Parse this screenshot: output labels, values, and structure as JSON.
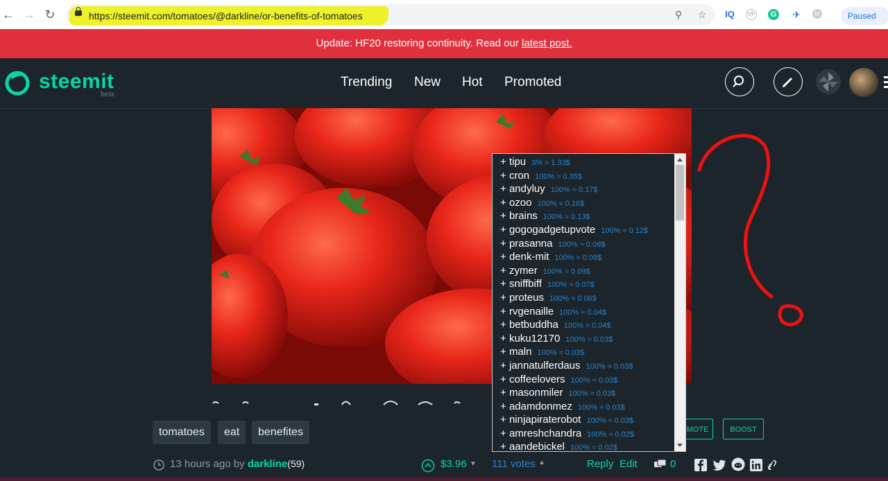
{
  "browser": {
    "url": "https://steemit.com/tomatoes/@darkline/or-benefits-of-tomatoes",
    "paused_label": "Paused",
    "ext_iq": "IQ",
    "ext_vp": "VP",
    "ext_g": "G",
    "ext_m": "M"
  },
  "banner": {
    "text": "Update: HF20 restoring continuity. Read our ",
    "link": "latest post."
  },
  "header": {
    "logo": "steemit",
    "beta": "beta",
    "nav": [
      "Trending",
      "New",
      "Hot",
      "Promoted"
    ]
  },
  "votes": [
    {
      "name": "tipu",
      "meta": "3% ≈ 1.33$"
    },
    {
      "name": "cron",
      "meta": "100% ≈ 0.35$"
    },
    {
      "name": "andyluy",
      "meta": "100% ≈ 0.17$"
    },
    {
      "name": "ozoo",
      "meta": "100% ≈ 0.16$"
    },
    {
      "name": "brains",
      "meta": "100% ≈ 0.13$"
    },
    {
      "name": "gogogadgetupvote",
      "meta": "100% ≈ 0.12$"
    },
    {
      "name": "prasanna",
      "meta": "100% ≈ 0.09$"
    },
    {
      "name": "denk-mit",
      "meta": "100% ≈ 0.09$"
    },
    {
      "name": "zymer",
      "meta": "100% ≈ 0.09$"
    },
    {
      "name": "sniffbiff",
      "meta": "100% ≈ 0.07$"
    },
    {
      "name": "proteus",
      "meta": "100% ≈ 0.06$"
    },
    {
      "name": "rvgenaille",
      "meta": "100% ≈ 0.04$"
    },
    {
      "name": "betbuddha",
      "meta": "100% ≈ 0.04$"
    },
    {
      "name": "kuku12170",
      "meta": "100% ≈ 0.03$"
    },
    {
      "name": "maln",
      "meta": "100% ≈ 0.03$"
    },
    {
      "name": "jannatulferdaus",
      "meta": "100% ≈ 0.03$"
    },
    {
      "name": "coffeelovers",
      "meta": "100% ≈ 0.03$"
    },
    {
      "name": "masonmiler",
      "meta": "100% ≈ 0.03$"
    },
    {
      "name": "adamdonmez",
      "meta": "100% ≈ 0.03$"
    },
    {
      "name": "ninjapiraterobot",
      "meta": "100% ≈ 0.03$"
    },
    {
      "name": "amreshchandra",
      "meta": "100% ≈ 0.02$"
    },
    {
      "name": "aandebickel",
      "meta": "100% ≈ 0.02$"
    }
  ],
  "tags": [
    "tomatoes",
    "eat",
    "benefites"
  ],
  "buttons": {
    "promote": "MOTE",
    "boost": "BOOST"
  },
  "post": {
    "time": "13 hours ago by ",
    "author": "darkline",
    "rep": "(59)",
    "payout": "$3.96",
    "votes_count": "111 votes",
    "reply": "Reply",
    "edit": "Edit",
    "comments": "0"
  },
  "colors": {
    "accent": "#06d6a9",
    "banner": "#e0303e",
    "bg": "#1c252b",
    "link": "#2e82c7"
  }
}
